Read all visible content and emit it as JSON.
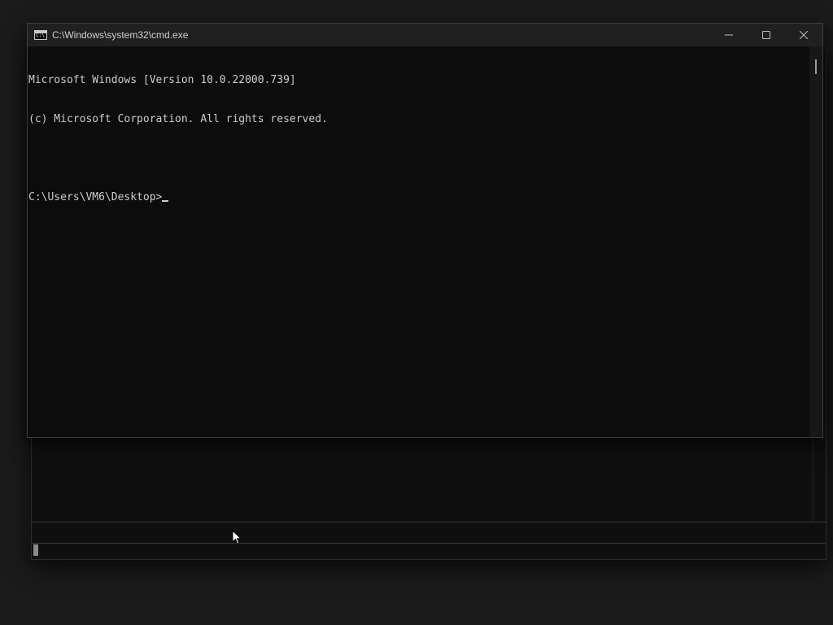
{
  "window": {
    "title": "C:\\Windows\\system32\\cmd.exe",
    "icon": "cmd-icon"
  },
  "titlebar_controls": [
    {
      "name": "minimize-button",
      "icon": "minimize-icon"
    },
    {
      "name": "maximize-button",
      "icon": "maximize-icon"
    },
    {
      "name": "close-button",
      "icon": "close-icon"
    }
  ],
  "console": {
    "lines": [
      "Microsoft Windows [Version 10.0.22000.739]",
      "(c) Microsoft Corporation. All rights reserved.",
      "",
      "C:\\Users\\VM6\\Desktop>"
    ]
  },
  "colors": {
    "console_bg": "#0c0c0c",
    "console_text": "#cccccc",
    "titlebar_bg": "#202020",
    "desktop_bg": "#1b1b1b"
  }
}
